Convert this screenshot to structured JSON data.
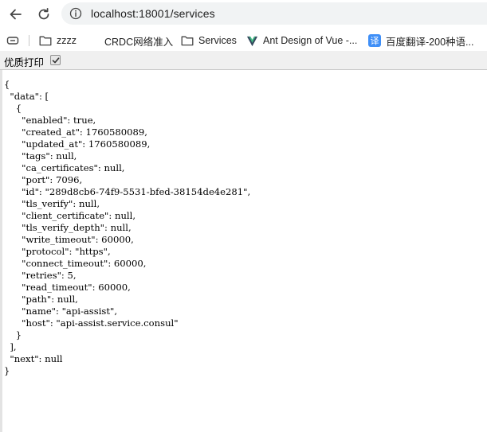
{
  "browser": {
    "url": "localhost:18001/services",
    "back_icon": "arrow-left-icon",
    "reload_icon": "reload-icon",
    "site_info_icon": "info-circle-icon"
  },
  "bookmarks": [
    {
      "label": "zzzz",
      "icon": "folder-icon"
    },
    {
      "label": "CRDC网络准入",
      "icon": "blank-favicon"
    },
    {
      "label": "Services",
      "icon": "folder-icon"
    },
    {
      "label": "Ant Design of Vue -...",
      "icon": "ant-design-vue-logo"
    },
    {
      "label": "百度翻译-200种语...",
      "icon": "baidu-fanyi-logo",
      "glyph": "译"
    }
  ],
  "pretty_print": {
    "label": "优质打印",
    "checked": true
  },
  "json_text": "{\n  \"data\": [\n    {\n      \"enabled\": true,\n      \"created_at\": 1760580089,\n      \"updated_at\": 1760580089,\n      \"tags\": null,\n      \"ca_certificates\": null,\n      \"port\": 7096,\n      \"id\": \"289d8cb6-74f9-5531-bfed-38154de4e281\",\n      \"tls_verify\": null,\n      \"client_certificate\": null,\n      \"tls_verify_depth\": null,\n      \"write_timeout\": 60000,\n      \"protocol\": \"https\",\n      \"connect_timeout\": 60000,\n      \"retries\": 5,\n      \"read_timeout\": 60000,\n      \"path\": null,\n      \"name\": \"api-assist\",\n      \"host\": \"api-assist.service.consul\"\n    }\n  ],\n  \"next\": null\n}"
}
